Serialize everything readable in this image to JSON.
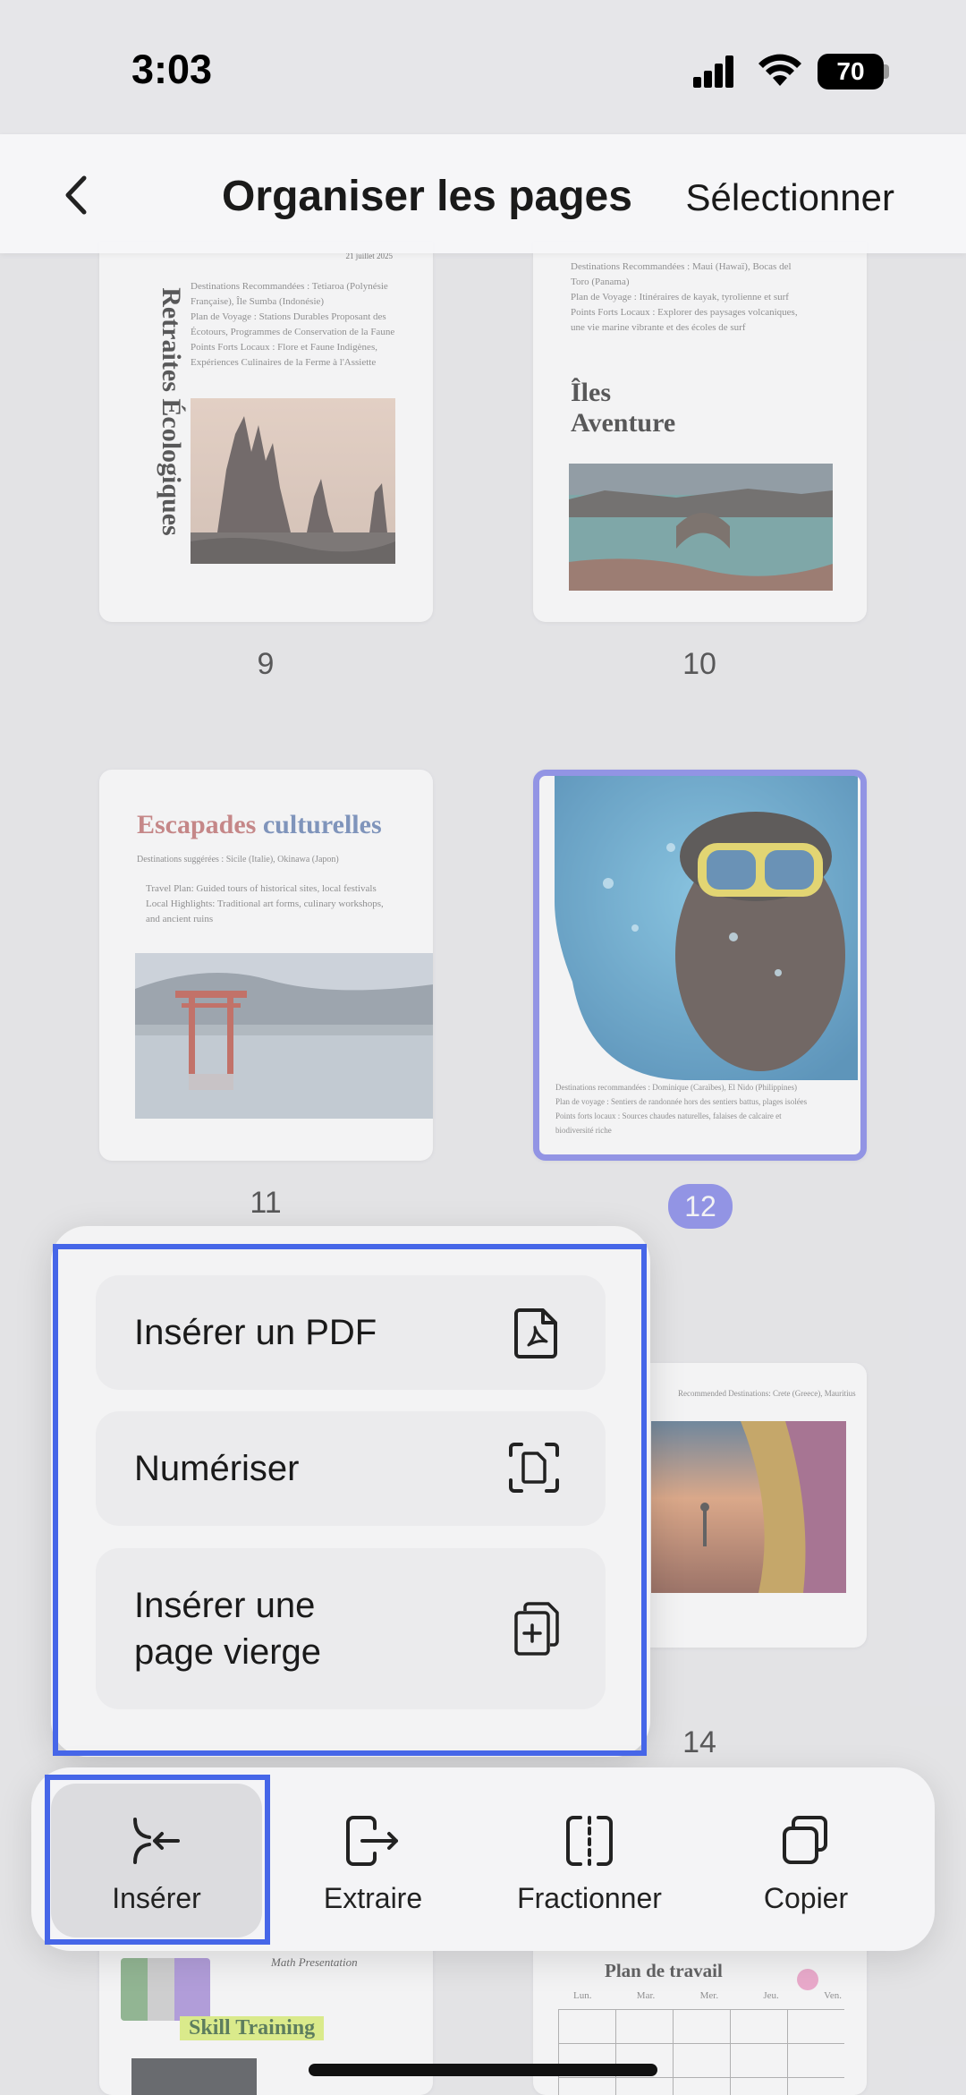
{
  "status_bar": {
    "time": "3:03",
    "battery": "70"
  },
  "nav": {
    "title": "Organiser les pages",
    "select_label": "Sélectionner"
  },
  "pages": {
    "p9": {
      "number": "9",
      "date": "21 juillet 2025",
      "title": "Retraites Écologiques",
      "lines": [
        "Destinations Recommandées : Tetiaroa (Polynésie",
        "Française), Île Sumba (Indonésie)",
        "Plan de Voyage : Stations Durables Proposant des",
        "Écotours, Programmes de Conservation de la Faune",
        "Points Forts Locaux : Flore et Faune Indigènes,",
        "Expériences Culinaires de la Ferme à l'Assiette"
      ]
    },
    "p10": {
      "number": "10",
      "title_line1": "Îles",
      "title_line2": "Aventure",
      "lines": [
        "Destinations Recommandées : Maui (Hawaï), Bocas del",
        "Toro (Panama)",
        "Plan de Voyage : Itinéraires de kayak, tyrolienne et surf",
        "Points Forts Locaux : Explorer des paysages volcaniques,",
        "une vie marine vibrante et des écoles de surf"
      ]
    },
    "p11": {
      "number": "11",
      "title_a": "Escapades ",
      "title_b": "culturelles",
      "subtitle": "Destinations suggérées : Sicile (Italie), Okinawa (Japon)",
      "lines": [
        "Travel Plan: Guided tours of historical sites, local festivals",
        "Local Highlights: Traditional art forms, culinary workshops,",
        "and ancient ruins"
      ]
    },
    "p12": {
      "number": "12",
      "lines": [
        "Destinations recommandées : Dominique (Caraïbes), El Nido (Philippines)",
        "Plan de voyage : Sentiers de randonnée hors des sentiers battus, plages isolées",
        "Points forts locaux : Sources chaudes naturelles, falaises de calcaire et",
        "biodiversité riche"
      ]
    },
    "p14": {
      "number": "14",
      "line": "Recommended Destinations: Crete (Greece), Mauritius"
    },
    "p15": {
      "title": "Skill Training",
      "header": "Math Presentation"
    },
    "p16": {
      "title": "Plan de travail",
      "days": [
        "Lun.",
        "Mar.",
        "Mer.",
        "Jeu.",
        "Ven."
      ]
    }
  },
  "insert_menu": {
    "items": [
      {
        "label": "Insérer un PDF",
        "icon": "pdf-file-icon"
      },
      {
        "label": "Numériser",
        "icon": "scan-document-icon"
      },
      {
        "label_line1": "Insérer une",
        "label_line2": "page vierge",
        "icon": "add-page-icon"
      }
    ]
  },
  "toolbar": {
    "insert": "Insérer",
    "extract": "Extraire",
    "split": "Fractionner",
    "copy": "Copier"
  },
  "colors": {
    "accent": "#6a6ee6",
    "highlight_outline": "#4666e8"
  }
}
